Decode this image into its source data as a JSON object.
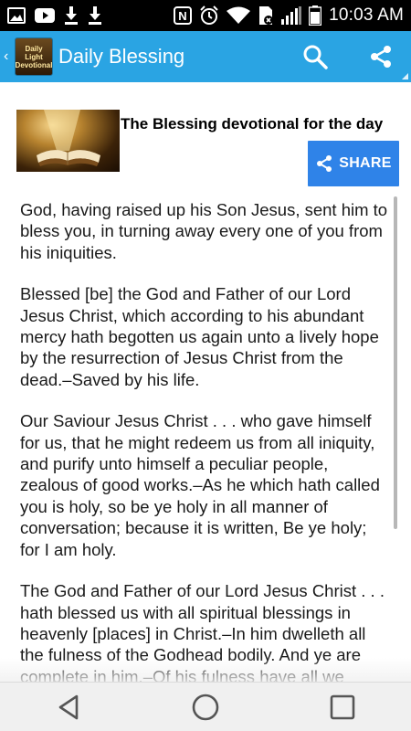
{
  "status_bar": {
    "time": "10:03 AM",
    "icons": [
      "image-icon",
      "youtube-icon",
      "download-icon",
      "download-icon",
      "nfc-icon",
      "alarm-icon",
      "wifi-icon",
      "sim-icon",
      "signal-icon",
      "battery-icon"
    ]
  },
  "app_bar": {
    "back": "‹",
    "logo_line1": "Daily",
    "logo_line2": "Light",
    "logo_line3": "Devotional",
    "title": "Daily Blessing",
    "actions": [
      "search-icon",
      "share-icon"
    ],
    "color": "#2aa4e3"
  },
  "header": {
    "title": "The Blessing devotional for the day",
    "share_label": "SHARE",
    "share_color": "#2f83e8"
  },
  "body": {
    "paragraphs": [
      "God, having raised up his Son Jesus, sent him to bless you, in turning away every one of you from his iniquities.",
      "Blessed [be] the God and Father of our Lord Jesus Christ, which according to his abundant mercy hath begotten us again unto a lively hope by the resurrection of Jesus Christ from the dead.–Saved by his life.",
      "Our Saviour Jesus Christ . . . who gave himself for us, that he might redeem us from all iniquity, and purify unto himself a peculiar people, zealous of good works.–As he which hath called you is holy, so be ye holy in all manner of conversation; because it is written, Be ye holy; for I am holy.",
      "The God and Father of our Lord Jesus Christ . . . hath blessed us with all spiritual blessings in heavenly [places] in Christ.–In him dwelleth all the fulness of the Godhead bodily. And ye are complete in him.–Of his fulness have all we received, and grace for grace."
    ]
  },
  "nav_bar": {
    "buttons": [
      "back-icon",
      "home-icon",
      "recents-icon"
    ]
  }
}
